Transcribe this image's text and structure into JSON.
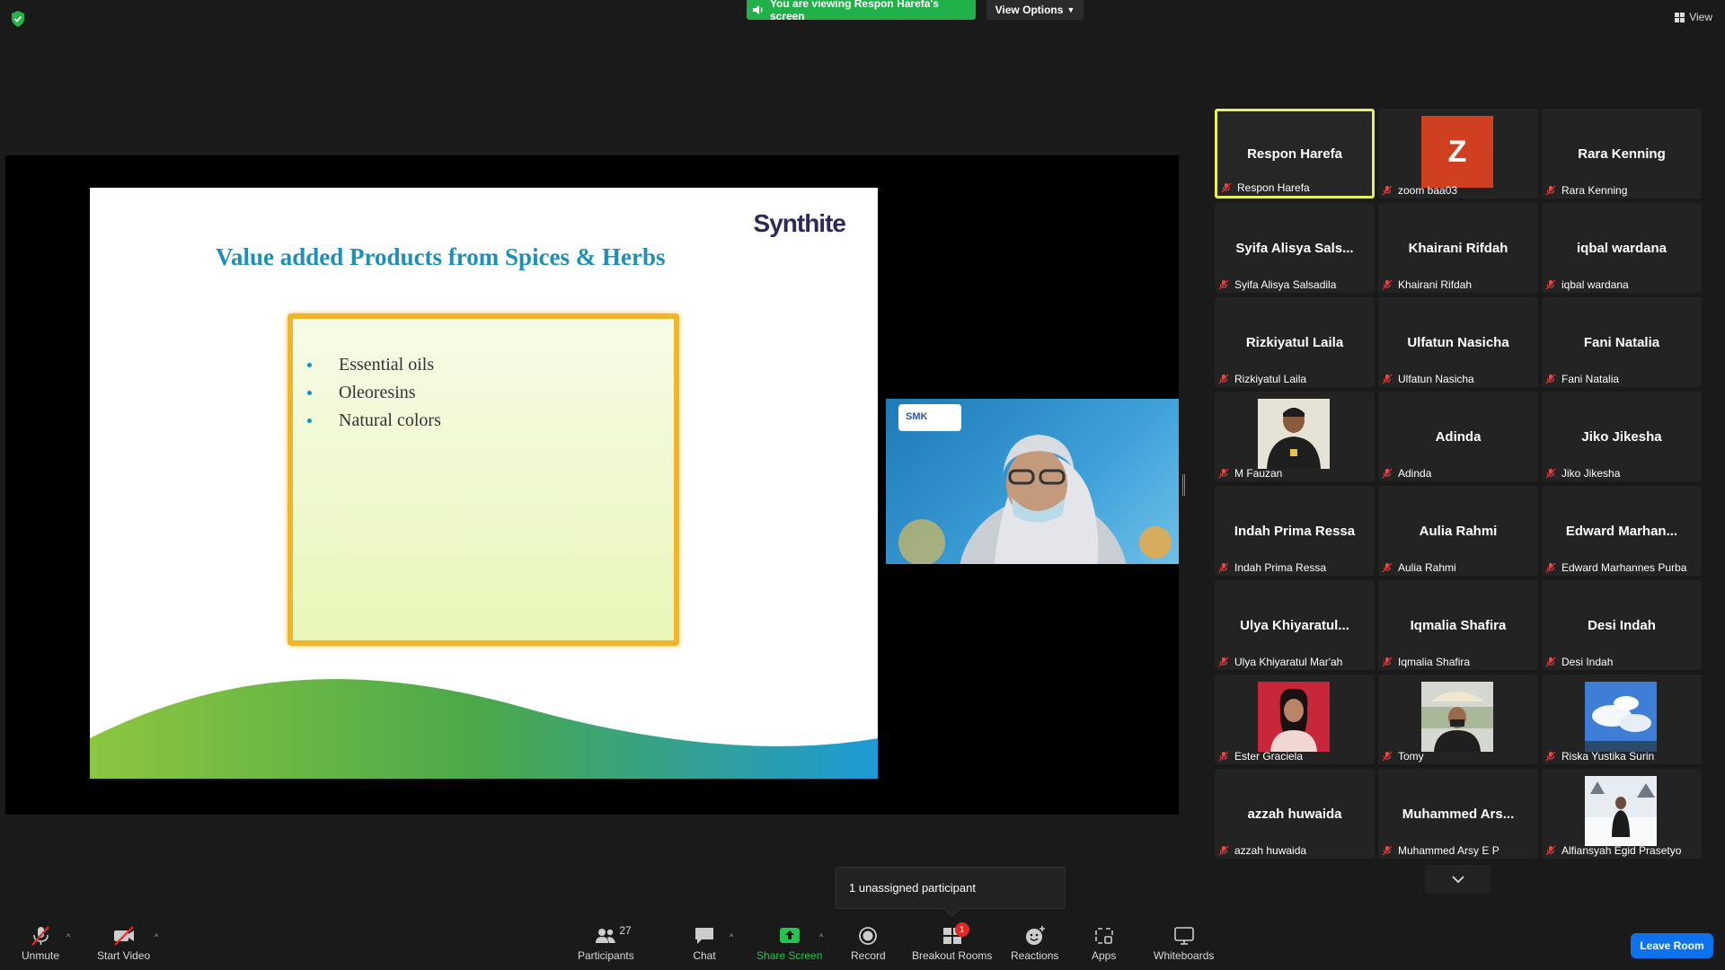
{
  "top": {
    "banner": "You are viewing Respon Harefa's screen",
    "view_options": "View Options",
    "view": "View"
  },
  "slide": {
    "logo": "Synthite",
    "title": "Value added Products from Spices & Herbs",
    "bullets": [
      "Essential oils",
      "Oleoresins",
      "Natural colors"
    ]
  },
  "speaker_cam": {
    "logo": "SMK"
  },
  "participants": [
    {
      "big": "Respon Harefa",
      "name": "Respon Harefa",
      "kind": "text",
      "active": true
    },
    {
      "big": "Z",
      "name": "zoom baa03",
      "kind": "avatar"
    },
    {
      "big": "Rara Kenning",
      "name": "Rara Kenning",
      "kind": "text"
    },
    {
      "big": "Syifa  Alisya  Sals...",
      "name": "Syifa Alisya Salsadila",
      "kind": "text"
    },
    {
      "big": "Khairani Rifdah",
      "name": "Khairani Rifdah",
      "kind": "text"
    },
    {
      "big": "iqbal wardana",
      "name": "iqbal wardana",
      "kind": "text"
    },
    {
      "big": "Rizkiyatul Laila",
      "name": "Rizkiyatul Laila",
      "kind": "text"
    },
    {
      "big": "Ulfatun Nasicha",
      "name": "Ulfatun Nasicha",
      "kind": "text"
    },
    {
      "big": "Fani Natalia",
      "name": "Fani Natalia",
      "kind": "text"
    },
    {
      "big": "",
      "name": "M Fauzan",
      "kind": "photo",
      "photo": "fauzan"
    },
    {
      "big": "Adinda",
      "name": "Adinda",
      "kind": "text"
    },
    {
      "big": "Jiko Jikesha",
      "name": "Jiko Jikesha",
      "kind": "text"
    },
    {
      "big": "Indah Prima Ressa",
      "name": "Indah Prima Ressa",
      "kind": "text"
    },
    {
      "big": "Aulia Rahmi",
      "name": "Aulia Rahmi",
      "kind": "text"
    },
    {
      "big": "Edward  Marhan...",
      "name": "Edward Marhannes Purba",
      "kind": "text"
    },
    {
      "big": "Ulya  Khiyaratul...",
      "name": "Ulya Khiyaratul Mar'ah",
      "kind": "text"
    },
    {
      "big": "Iqmalia Shafira",
      "name": "Iqmalia Shafira",
      "kind": "text"
    },
    {
      "big": "Desi Indah",
      "name": "Desi Indah",
      "kind": "text"
    },
    {
      "big": "",
      "name": "Ester Graciela",
      "kind": "photo",
      "photo": "ester"
    },
    {
      "big": "",
      "name": "Tomy",
      "kind": "photo",
      "photo": "tomy"
    },
    {
      "big": "",
      "name": "Riska Yustika Surin",
      "kind": "photo",
      "photo": "riska"
    },
    {
      "big": "azzah huwaida",
      "name": "azzah huwaida",
      "kind": "text"
    },
    {
      "big": "Muhammed  Ars...",
      "name": "Muhammed Arsy E P",
      "kind": "text"
    },
    {
      "big": "",
      "name": "Alfiansyah Egid Prasetyo",
      "kind": "photo",
      "photo": "alfiansyah"
    }
  ],
  "tooltip": "1 unassigned participant",
  "toolbar": {
    "unmute": "Unmute",
    "start_video": "Start Video",
    "participants": "Participants",
    "participants_count": "27",
    "chat": "Chat",
    "share_screen": "Share Screen",
    "record": "Record",
    "breakout_rooms": "Breakout Rooms",
    "breakout_badge": "1",
    "reactions": "Reactions",
    "apps": "Apps",
    "whiteboards": "Whiteboards",
    "leave_room": "Leave Room"
  },
  "colors": {
    "active_border": "#e6f05a",
    "share_green": "#25c44e",
    "leave_blue": "#0e72ed",
    "muted_red": "#e02828",
    "avatar_z": "#d04020"
  }
}
